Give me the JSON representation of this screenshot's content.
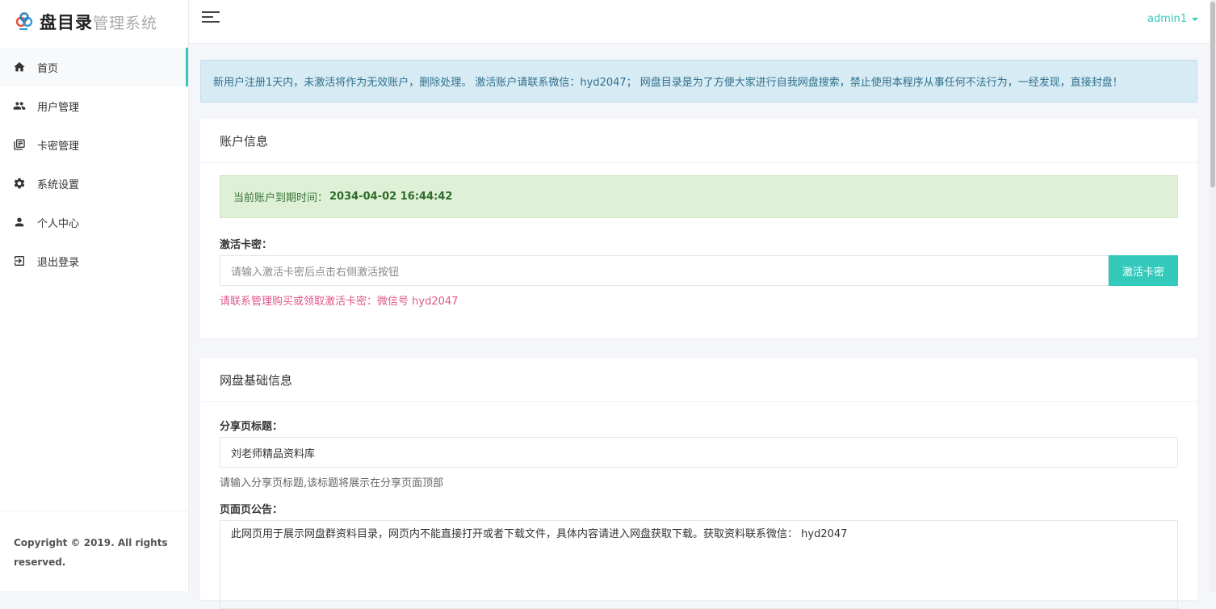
{
  "brand": {
    "main": "盘目录",
    "sub": "管理系统"
  },
  "sidebar": {
    "items": [
      {
        "label": "首页",
        "icon": "home-icon"
      },
      {
        "label": "用户管理",
        "icon": "users-icon"
      },
      {
        "label": "卡密管理",
        "icon": "cards-icon"
      },
      {
        "label": "系统设置",
        "icon": "gear-icon"
      },
      {
        "label": "个人中心",
        "icon": "person-icon"
      },
      {
        "label": "退出登录",
        "icon": "logout-icon"
      }
    ],
    "footer": "Copyright © 2019. All rights reserved."
  },
  "header": {
    "user": "admin1"
  },
  "notice": "新用户注册1天内，未激活将作为无效账户，删除处理。 激活账户请联系微信：hyd2047； 网盘目录是为了方便大家进行自我网盘搜索，禁止使用本程序从事任何不法行为，一经发现，直接封盘！",
  "account": {
    "title": "账户信息",
    "expiry_label": "当前账户到期时间：",
    "expiry_value": "2034-04-02 16:44:42",
    "card_label": "激活卡密：",
    "card_placeholder": "请输入激活卡密后点击右侧激活按钮",
    "activate_button": "激活卡密",
    "help": "请联系管理购买或领取激活卡密：微信号 hyd2047"
  },
  "netdisk": {
    "title": "网盘基础信息",
    "share_title_label": "分享页标题：",
    "share_title_value": "刘老师精品资料库",
    "share_title_help": "请输入分享页标题,该标题将展示在分享页面顶部",
    "notice_label": "页面页公告：",
    "notice_value": "此网页用于展示网盘群资料目录，网页内不能直接打开或者下载文件，具体内容请进入网盘获取下载。获取资料联系微信： hyd2047"
  },
  "colors": {
    "accent": "#33cabb",
    "notice_bg": "#d6ebf3",
    "success_bg": "#def0d6",
    "help_pink": "#e0568a"
  }
}
